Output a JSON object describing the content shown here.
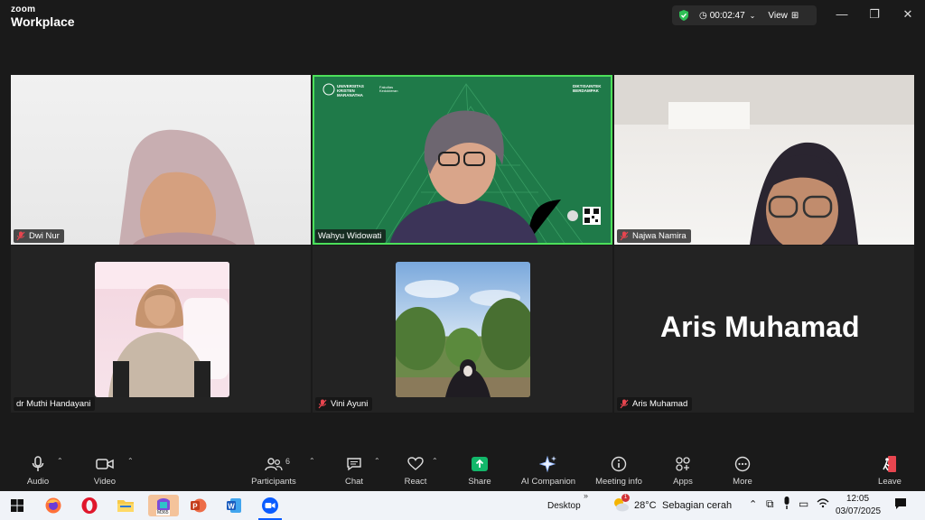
{
  "app": {
    "brand_line1": "zoom",
    "brand_line2": "Workplace",
    "timer": "00:02:47",
    "view_label": "View",
    "colors": {
      "accent": "#4ce05a",
      "bg": "#1a1a1a",
      "green_slide": "#1f7a49",
      "leave": "#e8454f",
      "share": "#12b76a"
    }
  },
  "participants": {
    "dwi": {
      "name": "Dwi Nur"
    },
    "wahyu": {
      "name": "Wahyu Widowati",
      "slide_logo": "UNIVERSITAS KRISTEN MARANATHA",
      "slide_unit": "Fakultas Kedokteran",
      "slide_right": "DIKTISAINTEK BERDAMPAK"
    },
    "najwa": {
      "name": "Najwa Namira"
    },
    "muthi": {
      "name": "dr Muthi Handayani"
    },
    "vini": {
      "name": "Vini Ayuni"
    },
    "aris": {
      "name": "Aris Muhamad",
      "display": "Aris Muhamad"
    }
  },
  "toolbar": {
    "audio": "Audio",
    "video": "Video",
    "participants": "Participants",
    "participant_count": "6",
    "chat": "Chat",
    "react": "React",
    "share": "Share",
    "ai_companion": "AI Companion",
    "meeting_info": "Meeting info",
    "apps": "Apps",
    "more": "More",
    "leave": "Leave"
  },
  "taskbar": {
    "desktop": "Desktop",
    "temperature": "28°C",
    "weather": "Sebagian cerah",
    "time": "12:05",
    "date": "03/07/2025",
    "badge": "M365",
    "weather_badge": "1"
  }
}
